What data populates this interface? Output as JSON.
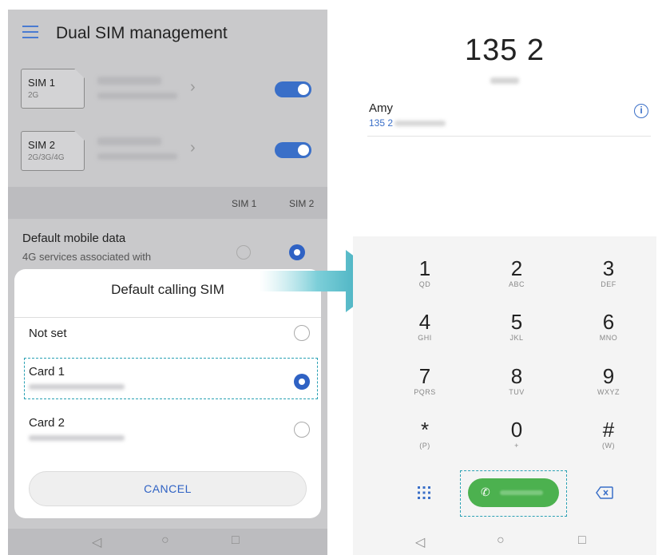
{
  "left_screen": {
    "header": {
      "title": "Dual SIM management",
      "menu_icon": "hamburger-icon"
    },
    "sim_cards": [
      {
        "label": "SIM 1",
        "network": "2G",
        "enabled": true
      },
      {
        "label": "SIM 2",
        "network": "2G/3G/4G",
        "enabled": true
      }
    ],
    "columns": {
      "sim1": "SIM 1",
      "sim2": "SIM 2"
    },
    "default_mobile_data": {
      "title": "Default mobile data",
      "subtitle": "4G services associated with",
      "selected": "SIM 2"
    },
    "dialog": {
      "title": "Default calling SIM",
      "options": [
        {
          "label": "Not set",
          "selected": false
        },
        {
          "label": "Card 1",
          "selected": true
        },
        {
          "label": "Card 2",
          "selected": false
        }
      ],
      "cancel_label": "CANCEL"
    },
    "navbar": {
      "back": "◁",
      "home": "○",
      "recent": "□"
    }
  },
  "right_screen": {
    "dialed_number": "135 2",
    "contact": {
      "name": "Amy",
      "number": "135 2"
    },
    "keypad": [
      {
        "digit": "1",
        "letters": "QD"
      },
      {
        "digit": "2",
        "letters": "ABC"
      },
      {
        "digit": "3",
        "letters": "DEF"
      },
      {
        "digit": "4",
        "letters": "GHI"
      },
      {
        "digit": "5",
        "letters": "JKL"
      },
      {
        "digit": "6",
        "letters": "MNO"
      },
      {
        "digit": "7",
        "letters": "PQRS"
      },
      {
        "digit": "8",
        "letters": "TUV"
      },
      {
        "digit": "9",
        "letters": "WXYZ"
      },
      {
        "digit": "*",
        "letters": "(P)"
      },
      {
        "digit": "0",
        "letters": "+"
      },
      {
        "digit": "#",
        "letters": "(W)"
      }
    ],
    "bottom": {
      "dialpad_icon": "dialpad-grid-icon",
      "call_icon": "phone-icon",
      "backspace_icon": "backspace-icon"
    },
    "navbar": {
      "back": "◁",
      "home": "○",
      "recent": "□"
    }
  },
  "colors": {
    "accent_blue": "#2f62c4",
    "call_green": "#4cb14f",
    "arrow_teal": "#2aa1b4"
  }
}
